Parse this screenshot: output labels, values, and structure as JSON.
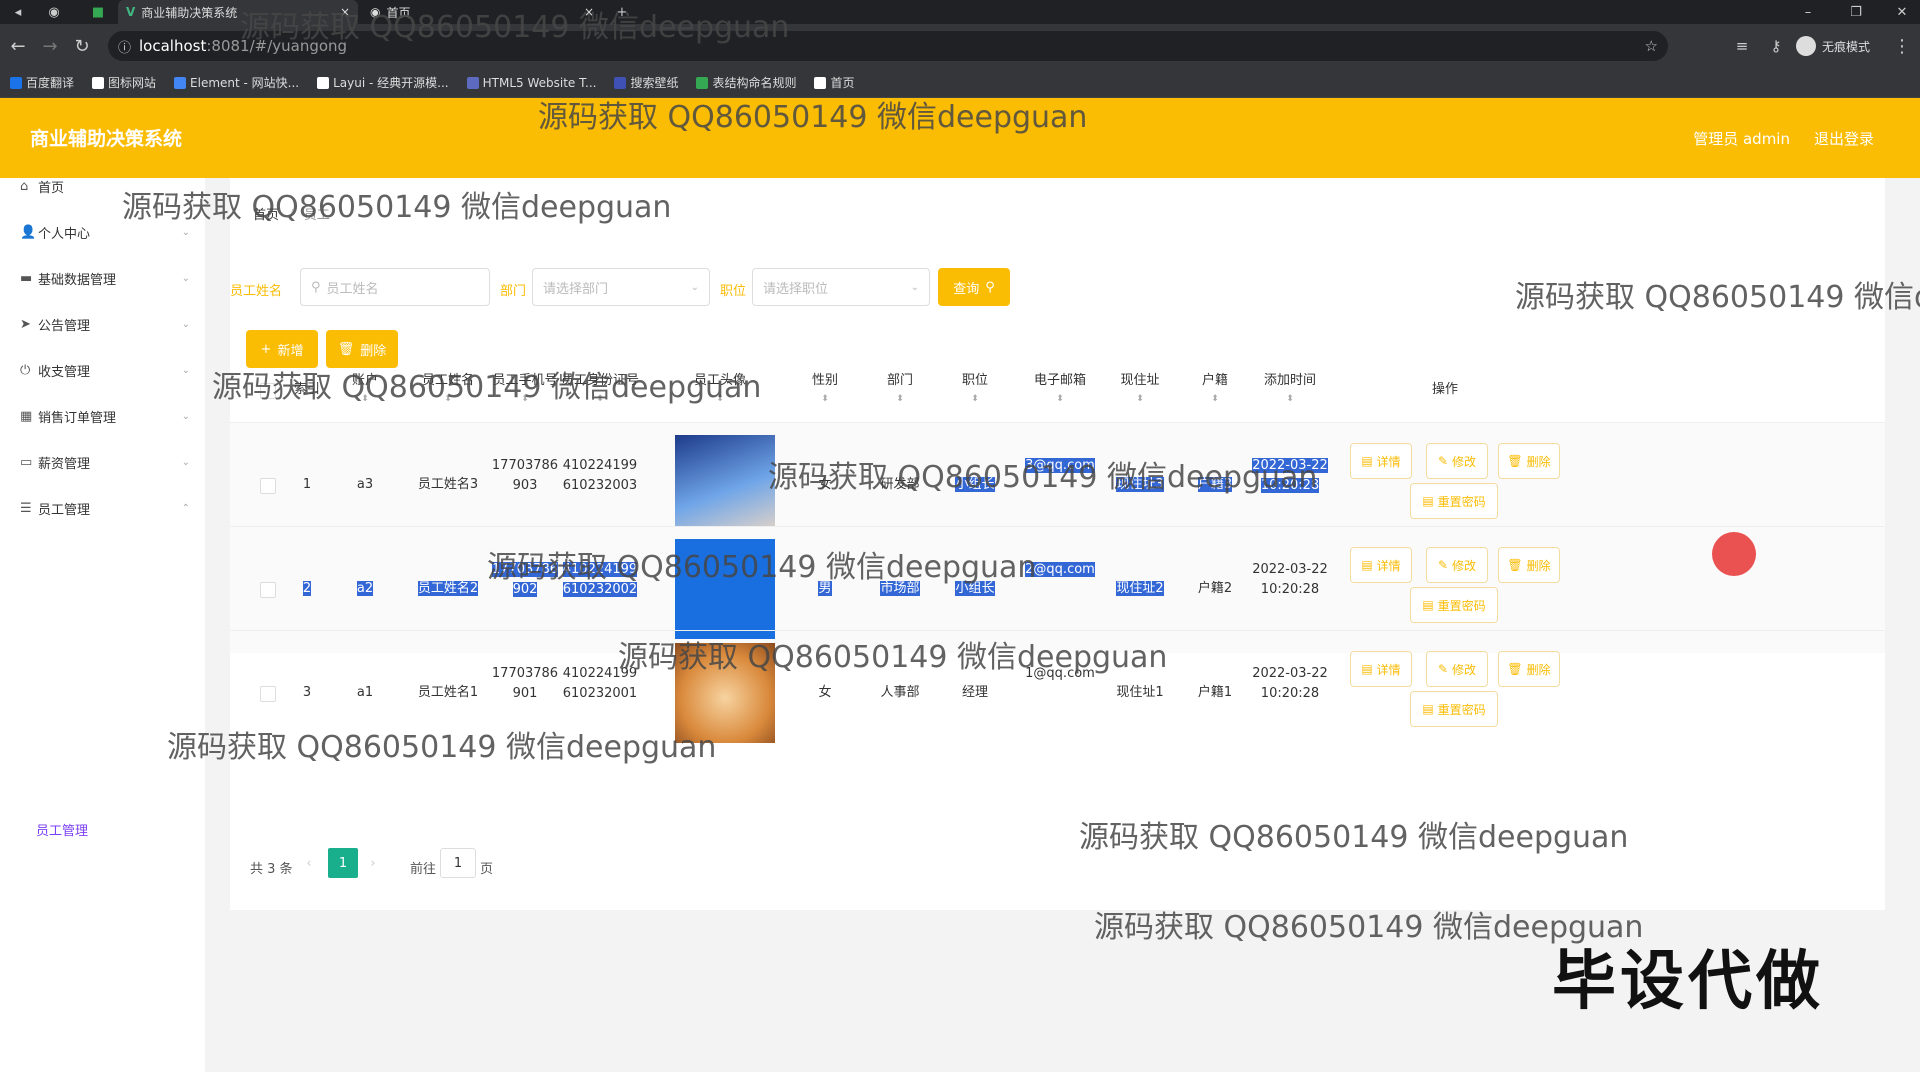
{
  "browser": {
    "tabs": [
      {
        "label": "商业辅助决策系统"
      },
      {
        "label": "首页"
      }
    ],
    "url_host": "localhost",
    "url_rest": ":8081/#/yuangong",
    "profile_label": "无痕模式",
    "bookmarks": [
      "百度翻译",
      "图标网站",
      "Element - 网站快...",
      "Layui - 经典开源模...",
      "HTML5 Website T...",
      "搜索壁纸",
      "表结构命名规则",
      "首页"
    ],
    "bookmark_colors": [
      "#1a73e8",
      "#ffffff",
      "#4285f4",
      "#ffffff",
      "#5c6bc0",
      "#3f51b5",
      "#34a853",
      "#ffffff"
    ]
  },
  "header": {
    "title": "商业辅助决策系统",
    "user": "管理员 admin",
    "logout": "退出登录"
  },
  "sidebar": {
    "items": [
      {
        "label": "首页",
        "icon": "home-icon",
        "glyph": "⌂"
      },
      {
        "label": "个人中心",
        "icon": "user-icon",
        "glyph": "👤"
      },
      {
        "label": "基础数据管理",
        "icon": "monitor-icon",
        "glyph": "▬"
      },
      {
        "label": "公告管理",
        "icon": "send-icon",
        "glyph": "➤"
      },
      {
        "label": "收支管理",
        "icon": "power-icon",
        "glyph": "⏻"
      },
      {
        "label": "销售订单管理",
        "icon": "grid-icon",
        "glyph": "▦"
      },
      {
        "label": "薪资管理",
        "icon": "wallet-icon",
        "glyph": "▭"
      },
      {
        "label": "员工管理",
        "icon": "list-icon",
        "glyph": "☰"
      }
    ],
    "active_sub": "员工管理"
  },
  "breadcrumb": {
    "home": "首页",
    "sep": "/",
    "current": "员工"
  },
  "search": {
    "name_label": "员工姓名",
    "name_placeholder": "员工姓名",
    "dept_label": "部门",
    "dept_placeholder": "请选择部门",
    "pos_label": "职位",
    "pos_placeholder": "请选择职位",
    "query_label": "查询"
  },
  "actions": {
    "add": "新增",
    "delete": "删除"
  },
  "table": {
    "headers": [
      "索引",
      "账户",
      "员工姓名",
      "员工手机号",
      "员工身份证号",
      "员工头像",
      "性别",
      "部门",
      "职位",
      "电子邮箱",
      "现住址",
      "户籍",
      "添加时间",
      "操作"
    ],
    "ops": {
      "detail": "详情",
      "edit": "修改",
      "delete": "删除",
      "reset": "重置密码"
    },
    "rows": [
      {
        "index": "1",
        "account": "a3",
        "name": "员工姓名3",
        "phone": "17703786903",
        "idno": "410224199610232003",
        "gender": "女",
        "dept": "研发部",
        "pos": "小组长",
        "email": "3@qq.com",
        "addr": "现住址3",
        "huji": "户籍3",
        "time": "2022-03-22 10:20:28"
      },
      {
        "index": "2",
        "account": "a2",
        "name": "员工姓名2",
        "phone": "17703786902",
        "idno": "410224199610232002",
        "gender": "男",
        "dept": "市场部",
        "pos": "小组长",
        "email": "2@qq.com",
        "addr": "现住址2",
        "huji": "户籍2",
        "time": "2022-03-22 10:20:28"
      },
      {
        "index": "3",
        "account": "a1",
        "name": "员工姓名1",
        "phone": "17703786901",
        "idno": "410224199610232001",
        "gender": "女",
        "dept": "人事部",
        "pos": "经理",
        "email": "1@qq.com",
        "addr": "现住址1",
        "huji": "户籍1",
        "time": "2022-03-22 10:20:28"
      }
    ]
  },
  "pager": {
    "total": "共 3 条",
    "current": "1",
    "goto": "前往",
    "goto_value": "1",
    "page_unit": "页"
  },
  "overlay": {
    "watermark": "源码获取 QQ86050149 微信deepguan",
    "stamp": "毕设代做"
  },
  "colors": {
    "accent": "#fbbc04",
    "selection": "#3367d6",
    "active_sub": "#7a3ff4"
  }
}
